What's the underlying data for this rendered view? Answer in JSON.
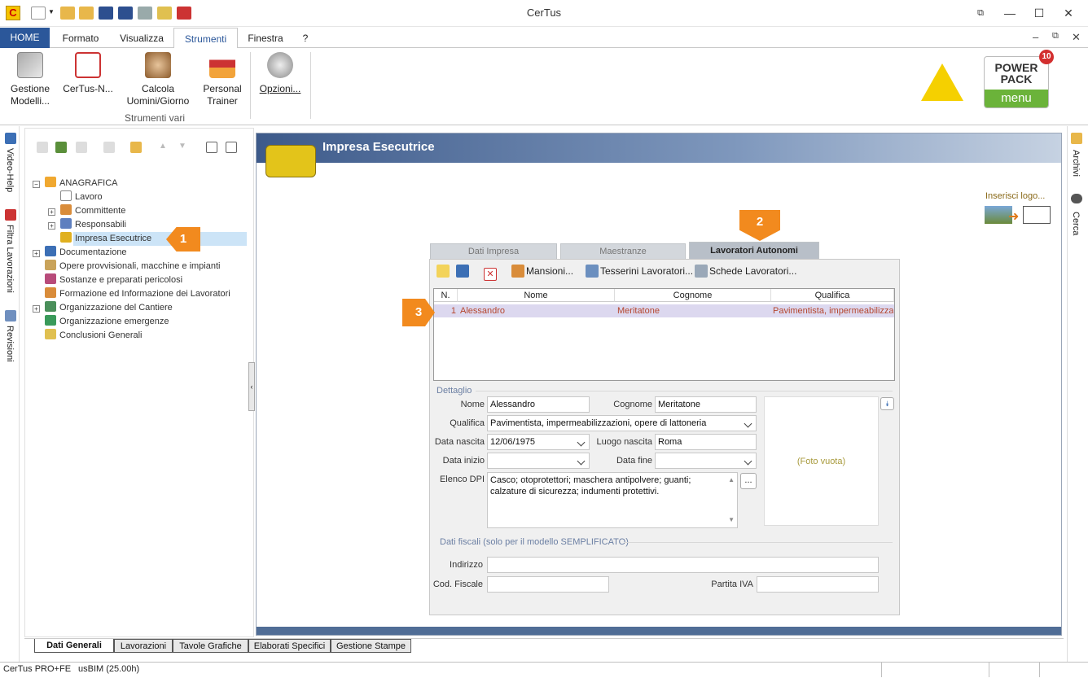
{
  "window": {
    "title": "CerTus",
    "app_logo_letter": "C"
  },
  "ribbon_tabs": [
    "HOME",
    "Formato",
    "Visualizza",
    "Strumenti",
    "Finestra",
    "?"
  ],
  "ribbon": {
    "buttons": [
      {
        "label1": "Gestione",
        "label2": "Modelli..."
      },
      {
        "label1": "CerTus-N...",
        "label2": ""
      },
      {
        "label1": "Calcola",
        "label2": "Uomini/Giorno"
      },
      {
        "label1": "Personal",
        "label2": "Trainer"
      },
      {
        "label1": "Opzioni...",
        "label2": ""
      }
    ],
    "group_label": "Strumenti vari",
    "powerpack": {
      "line1": "POWER",
      "line2": "PACK",
      "line3": "menu",
      "badge": "10"
    }
  },
  "left_strip": [
    "Video-Help",
    "Filtra Lavorazioni",
    "Revisioni"
  ],
  "right_strip": [
    "Archivi",
    "Cerca"
  ],
  "tree": [
    {
      "label": "ANAGRAFICA",
      "level": 0,
      "expander": "−"
    },
    {
      "label": "Lavoro",
      "level": 1,
      "expander": ""
    },
    {
      "label": "Committente",
      "level": 1,
      "expander": "+"
    },
    {
      "label": "Responsabili",
      "level": 1,
      "expander": "+"
    },
    {
      "label": "Impresa Esecutrice",
      "level": 1,
      "expander": ""
    },
    {
      "label": "Documentazione",
      "level": 0,
      "expander": "+"
    },
    {
      "label": "Opere provvisionali, macchine e impianti",
      "level": 0,
      "expander": ""
    },
    {
      "label": "Sostanze e preparati pericolosi",
      "level": 0,
      "expander": ""
    },
    {
      "label": "Formazione ed Informazione dei Lavoratori",
      "level": 0,
      "expander": ""
    },
    {
      "label": "Organizzazione del Cantiere",
      "level": 0,
      "expander": "+"
    },
    {
      "label": "Organizzazione emergenze",
      "level": 0,
      "expander": ""
    },
    {
      "label": "Conclusioni Generali",
      "level": 0,
      "expander": ""
    }
  ],
  "callouts": {
    "c1": "1",
    "c2": "2",
    "c3": "3"
  },
  "main": {
    "title": "Impresa Esecutrice",
    "insert_logo": "Inserisci logo...",
    "tabs": [
      "Dati Impresa",
      "Maestranze",
      "Lavoratori Autonomi"
    ],
    "toolbar": {
      "mansioni": "Mansioni...",
      "tesserini": "Tesserini Lavoratori...",
      "schede": "Schede Lavoratori..."
    },
    "grid": {
      "headers": [
        "N.",
        "Nome",
        "Cognome",
        "Qualifica"
      ],
      "rows": [
        {
          "n": "1",
          "nome": "Alessandro",
          "cognome": "Meritatone",
          "qualifica": "Pavimentista, impermeabilizzaz"
        }
      ]
    },
    "detail": {
      "section": "Dettaglio",
      "labels": {
        "nome": "Nome",
        "cognome": "Cognome",
        "qualifica": "Qualifica",
        "data_nascita": "Data nascita",
        "luogo_nascita": "Luogo nascita",
        "data_inizio": "Data inizio",
        "data_fine": "Data fine",
        "elenco_dpi": "Elenco DPI"
      },
      "values": {
        "nome": "Alessandro",
        "cognome": "Meritatone",
        "qualifica": "Pavimentista, impermeabilizzazioni, opere di lattoneria",
        "data_nascita": "12/06/1975",
        "luogo_nascita": "Roma",
        "data_inizio": "",
        "data_fine": "",
        "dpi_line1": "Casco; otoprotettori; maschera antipolvere; guanti;",
        "dpi_line2": "calzature di sicurezza; indumenti protettivi."
      },
      "dpi_button": "...",
      "foto": "(Foto vuota)"
    },
    "fiscal": {
      "section": "Dati fiscali (solo per il modello SEMPLIFICATO)",
      "labels": {
        "indirizzo": "Indirizzo",
        "cod_fiscale": "Cod. Fiscale",
        "partita_iva": "Partita IVA"
      },
      "values": {
        "indirizzo": "",
        "cod_fiscale": "",
        "partita_iva": ""
      }
    }
  },
  "bottom_tabs": [
    "Dati Generali",
    "Lavorazioni",
    "Tavole Grafiche",
    "Elaborati Specifici",
    "Gestione Stampe"
  ],
  "status": {
    "left": "CerTus PRO+FE",
    "right": "usBIM (25.00h)"
  },
  "colors": {
    "accent": "#2b579a",
    "callout": "#f28a1e",
    "header": "#3d5a8a",
    "row_text": "#b5462e"
  }
}
